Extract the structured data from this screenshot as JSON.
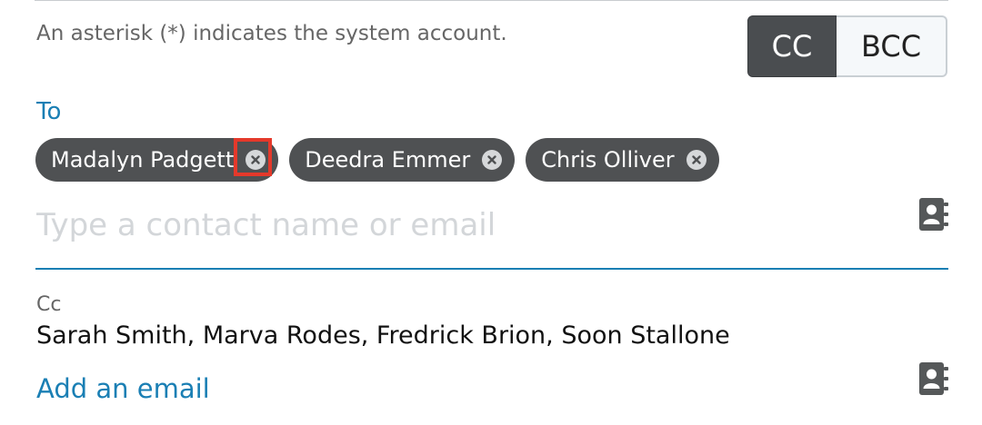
{
  "hint_text": "An asterisk (*) indicates the system account.",
  "toggle": {
    "cc_label": "CC",
    "bcc_label": "BCC",
    "active": "CC"
  },
  "to": {
    "label": "To",
    "recipients": [
      {
        "name": "Madalyn Padgett"
      },
      {
        "name": "Deedra Emmer"
      },
      {
        "name": "Chris Olliver"
      }
    ],
    "input_placeholder": "Type a contact name or email",
    "input_value": ""
  },
  "cc": {
    "label": "Cc",
    "value": "Sarah Smith, Marva Rodes, Fredrick Brion, Soon Stallone",
    "add_label": "Add an email"
  },
  "icons": {
    "remove": "close-circle-icon",
    "address_book": "address-book-icon"
  },
  "colors": {
    "accent": "#1a7fb4",
    "pill_bg": "#4f5153",
    "toggle_active_bg": "#4a4d50",
    "highlight": "#e5392b"
  }
}
